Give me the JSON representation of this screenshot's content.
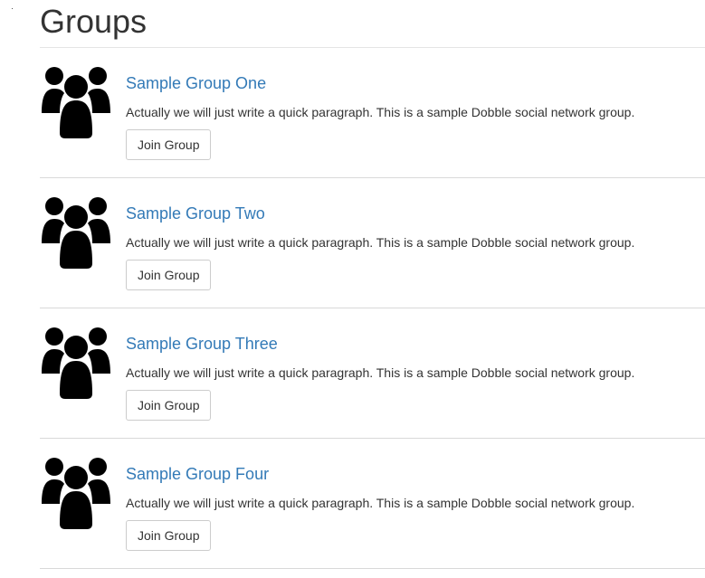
{
  "page": {
    "title": "Groups"
  },
  "groups": [
    {
      "name": "Sample Group One",
      "description": "Actually we will just write a quick paragraph. This is a sample Dobble social network group.",
      "button_label": "Join Group",
      "icon": "users-icon"
    },
    {
      "name": "Sample Group Two",
      "description": "Actually we will just write a quick paragraph. This is a sample Dobble social network group.",
      "button_label": "Join Group",
      "icon": "users-icon"
    },
    {
      "name": "Sample Group Three",
      "description": "Actually we will just write a quick paragraph. This is a sample Dobble social network group.",
      "button_label": "Join Group",
      "icon": "users-icon"
    },
    {
      "name": "Sample Group Four",
      "description": "Actually we will just write a quick paragraph. This is a sample Dobble social network group.",
      "button_label": "Join Group",
      "icon": "users-icon"
    }
  ],
  "colors": {
    "link": "#337ab7",
    "text": "#333333",
    "divider": "#d9d9d9",
    "button_border": "#cccccc"
  }
}
